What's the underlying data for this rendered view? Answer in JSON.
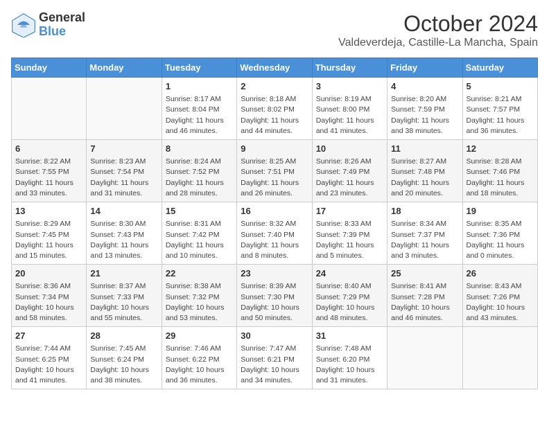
{
  "header": {
    "logo_general": "General",
    "logo_blue": "Blue",
    "month": "October 2024",
    "location": "Valdeverdeja, Castille-La Mancha, Spain"
  },
  "weekdays": [
    "Sunday",
    "Monday",
    "Tuesday",
    "Wednesday",
    "Thursday",
    "Friday",
    "Saturday"
  ],
  "weeks": [
    [
      {
        "day": "",
        "info": ""
      },
      {
        "day": "",
        "info": ""
      },
      {
        "day": "1",
        "info": "Sunrise: 8:17 AM\nSunset: 8:04 PM\nDaylight: 11 hours and 46 minutes."
      },
      {
        "day": "2",
        "info": "Sunrise: 8:18 AM\nSunset: 8:02 PM\nDaylight: 11 hours and 44 minutes."
      },
      {
        "day": "3",
        "info": "Sunrise: 8:19 AM\nSunset: 8:00 PM\nDaylight: 11 hours and 41 minutes."
      },
      {
        "day": "4",
        "info": "Sunrise: 8:20 AM\nSunset: 7:59 PM\nDaylight: 11 hours and 38 minutes."
      },
      {
        "day": "5",
        "info": "Sunrise: 8:21 AM\nSunset: 7:57 PM\nDaylight: 11 hours and 36 minutes."
      }
    ],
    [
      {
        "day": "6",
        "info": "Sunrise: 8:22 AM\nSunset: 7:55 PM\nDaylight: 11 hours and 33 minutes."
      },
      {
        "day": "7",
        "info": "Sunrise: 8:23 AM\nSunset: 7:54 PM\nDaylight: 11 hours and 31 minutes."
      },
      {
        "day": "8",
        "info": "Sunrise: 8:24 AM\nSunset: 7:52 PM\nDaylight: 11 hours and 28 minutes."
      },
      {
        "day": "9",
        "info": "Sunrise: 8:25 AM\nSunset: 7:51 PM\nDaylight: 11 hours and 26 minutes."
      },
      {
        "day": "10",
        "info": "Sunrise: 8:26 AM\nSunset: 7:49 PM\nDaylight: 11 hours and 23 minutes."
      },
      {
        "day": "11",
        "info": "Sunrise: 8:27 AM\nSunset: 7:48 PM\nDaylight: 11 hours and 20 minutes."
      },
      {
        "day": "12",
        "info": "Sunrise: 8:28 AM\nSunset: 7:46 PM\nDaylight: 11 hours and 18 minutes."
      }
    ],
    [
      {
        "day": "13",
        "info": "Sunrise: 8:29 AM\nSunset: 7:45 PM\nDaylight: 11 hours and 15 minutes."
      },
      {
        "day": "14",
        "info": "Sunrise: 8:30 AM\nSunset: 7:43 PM\nDaylight: 11 hours and 13 minutes."
      },
      {
        "day": "15",
        "info": "Sunrise: 8:31 AM\nSunset: 7:42 PM\nDaylight: 11 hours and 10 minutes."
      },
      {
        "day": "16",
        "info": "Sunrise: 8:32 AM\nSunset: 7:40 PM\nDaylight: 11 hours and 8 minutes."
      },
      {
        "day": "17",
        "info": "Sunrise: 8:33 AM\nSunset: 7:39 PM\nDaylight: 11 hours and 5 minutes."
      },
      {
        "day": "18",
        "info": "Sunrise: 8:34 AM\nSunset: 7:37 PM\nDaylight: 11 hours and 3 minutes."
      },
      {
        "day": "19",
        "info": "Sunrise: 8:35 AM\nSunset: 7:36 PM\nDaylight: 11 hours and 0 minutes."
      }
    ],
    [
      {
        "day": "20",
        "info": "Sunrise: 8:36 AM\nSunset: 7:34 PM\nDaylight: 10 hours and 58 minutes."
      },
      {
        "day": "21",
        "info": "Sunrise: 8:37 AM\nSunset: 7:33 PM\nDaylight: 10 hours and 55 minutes."
      },
      {
        "day": "22",
        "info": "Sunrise: 8:38 AM\nSunset: 7:32 PM\nDaylight: 10 hours and 53 minutes."
      },
      {
        "day": "23",
        "info": "Sunrise: 8:39 AM\nSunset: 7:30 PM\nDaylight: 10 hours and 50 minutes."
      },
      {
        "day": "24",
        "info": "Sunrise: 8:40 AM\nSunset: 7:29 PM\nDaylight: 10 hours and 48 minutes."
      },
      {
        "day": "25",
        "info": "Sunrise: 8:41 AM\nSunset: 7:28 PM\nDaylight: 10 hours and 46 minutes."
      },
      {
        "day": "26",
        "info": "Sunrise: 8:43 AM\nSunset: 7:26 PM\nDaylight: 10 hours and 43 minutes."
      }
    ],
    [
      {
        "day": "27",
        "info": "Sunrise: 7:44 AM\nSunset: 6:25 PM\nDaylight: 10 hours and 41 minutes."
      },
      {
        "day": "28",
        "info": "Sunrise: 7:45 AM\nSunset: 6:24 PM\nDaylight: 10 hours and 38 minutes."
      },
      {
        "day": "29",
        "info": "Sunrise: 7:46 AM\nSunset: 6:22 PM\nDaylight: 10 hours and 36 minutes."
      },
      {
        "day": "30",
        "info": "Sunrise: 7:47 AM\nSunset: 6:21 PM\nDaylight: 10 hours and 34 minutes."
      },
      {
        "day": "31",
        "info": "Sunrise: 7:48 AM\nSunset: 6:20 PM\nDaylight: 10 hours and 31 minutes."
      },
      {
        "day": "",
        "info": ""
      },
      {
        "day": "",
        "info": ""
      }
    ]
  ]
}
